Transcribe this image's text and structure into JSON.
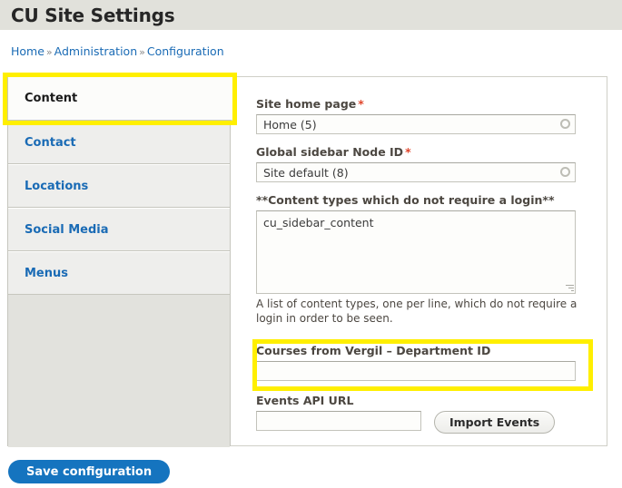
{
  "header": {
    "title": "CU Site Settings"
  },
  "breadcrumb": {
    "separator": "»",
    "items": [
      {
        "label": "Home"
      },
      {
        "label": "Administration"
      },
      {
        "label": "Configuration"
      }
    ]
  },
  "vertical_tabs": {
    "items": [
      {
        "label": "Content",
        "selected": true
      },
      {
        "label": "Contact",
        "selected": false
      },
      {
        "label": "Locations",
        "selected": false
      },
      {
        "label": "Social Media",
        "selected": false
      },
      {
        "label": "Menus",
        "selected": false
      }
    ]
  },
  "form": {
    "site_home_page": {
      "label": "Site home page",
      "required_marker": "*",
      "value": "Home (5)",
      "placeholder": "",
      "throbber_icon": "circle-throbber-icon"
    },
    "global_sidebar_node_id": {
      "label": "Global sidebar Node ID",
      "required_marker": "*",
      "value": "Site default (8)",
      "placeholder": "",
      "throbber_icon": "circle-throbber-icon"
    },
    "content_types_no_login": {
      "label": "**Content types which do not require a login**",
      "value": "cu_sidebar_content",
      "placeholder": "",
      "description": "A list of content types, one per line, which do not require a login in order to be seen.",
      "resize_handle_icon": "resize-grip-icon"
    },
    "vergil_department_id": {
      "label": "Courses from Vergil – Department ID",
      "value": "",
      "placeholder": ""
    },
    "events_api_url": {
      "label": "Events API URL",
      "value": "",
      "placeholder": ""
    },
    "import_events_button": {
      "label": "Import Events"
    }
  },
  "actions": {
    "save_label": "Save configuration"
  },
  "highlights": {
    "color": "#ffef00",
    "regions": [
      {
        "name": "content-tab",
        "note": "Content tab"
      },
      {
        "name": "vergil-department-id",
        "note": "Courses from Vergil – Department ID field"
      }
    ]
  }
}
